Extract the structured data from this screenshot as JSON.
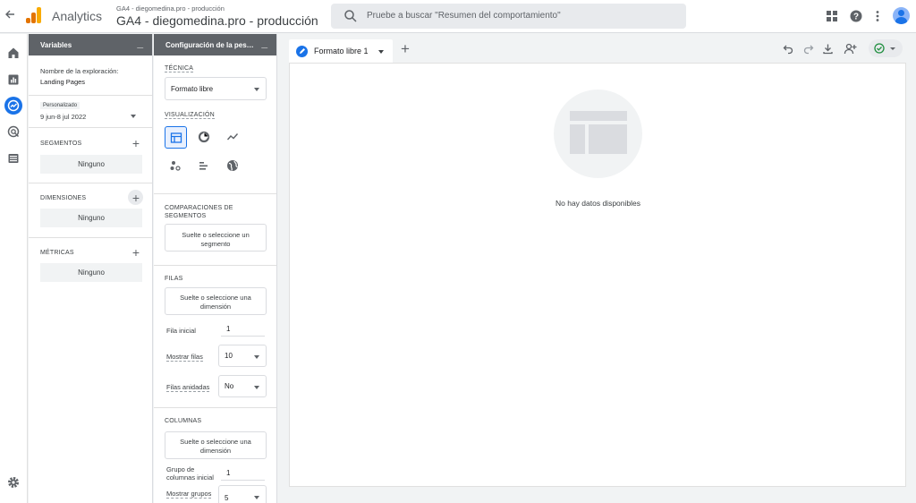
{
  "app": {
    "back_icon": "arrow-left-icon",
    "name": "Analytics",
    "property_small": "GA4 - diegomedina.pro - producción",
    "property_big": "GA4 - diegomedina.pro - producción",
    "search_placeholder": "Pruebe a buscar \"Resumen del comportamiento\"",
    "logo_colors": [
      "#f9ab00",
      "#e37400",
      "#e37400"
    ],
    "accent": "#1a73e8"
  },
  "topbar_icons": [
    "apps-grid-icon",
    "help-icon",
    "more-vert-icon",
    "account-avatar"
  ],
  "rail": [
    "home-icon",
    "reports-icon",
    "explore-icon",
    "advertising-icon",
    "configure-icon",
    "settings-icon"
  ],
  "variables": {
    "title": "Variables",
    "exploration_name_label": "Nombre de la exploración:",
    "exploration_name": "Landing Pages",
    "date_badge": "Personalizado",
    "date_range": "9 jun-8 jul 2022",
    "segments_label": "SEGMENTOS",
    "segments_value": "Ninguno",
    "dimensions_label": "DIMENSIONES",
    "dimensions_value": "Ninguno",
    "metrics_label": "MÉTRICAS",
    "metrics_value": "Ninguno"
  },
  "settings": {
    "title": "Configuración de la pes…",
    "technique_label": "TÉCNICA",
    "technique_value": "Formato libre",
    "visualization_label": "VISUALIZACIÓN",
    "visualizations": [
      "table-icon",
      "donut-chart-icon",
      "line-chart-icon",
      "scatter-plot-icon",
      "bar-chart-icon",
      "geo-map-icon"
    ],
    "segment_comparisons_label": "COMPARACIONES DE SEGMENTOS",
    "segment_drop": "Suelte o seleccione un segmento",
    "rows_label": "FILAS",
    "rows_drop": "Suelte o seleccione una dimensión",
    "start_row_label": "Fila inicial",
    "start_row_value": "1",
    "show_rows_label": "Mostrar filas",
    "show_rows_value": "10",
    "nested_rows_label": "Filas anidadas",
    "nested_rows_value": "No",
    "columns_label": "COLUMNAS",
    "columns_drop": "Suelte o seleccione una dimensión",
    "start_column_group_label": "Grupo de columnas inicial",
    "start_column_group_value": "1",
    "show_groups_label": "Mostrar grupos",
    "show_groups_value": "5"
  },
  "canvas": {
    "tab_label": "Formato libre 1",
    "toolbar": [
      "undo-icon",
      "redo-icon",
      "download-icon",
      "share-icon",
      "check-circle-icon"
    ],
    "empty_text": "No hay datos disponibles"
  }
}
